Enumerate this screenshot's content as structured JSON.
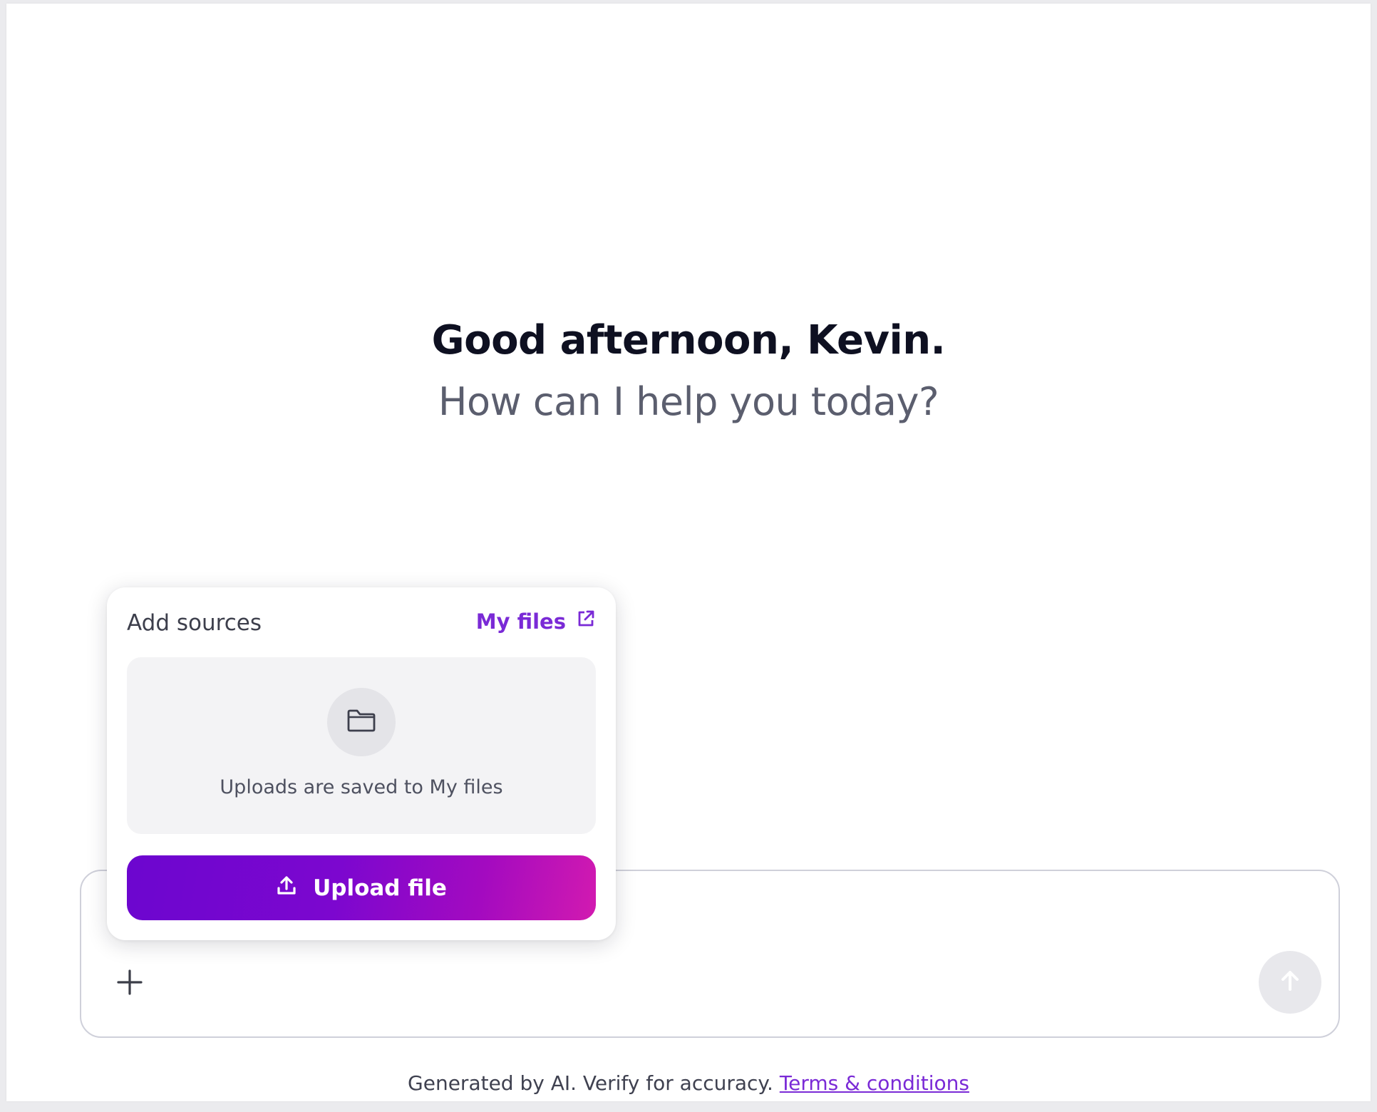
{
  "greeting": {
    "title": "Good afternoon, Kevin.",
    "subtitle": "How can I help you today?"
  },
  "sources_popover": {
    "title": "Add sources",
    "my_files_label": "My files",
    "my_files_icon": "external-link-icon",
    "dropzone_icon": "folder-icon",
    "dropzone_text": "Uploads are saved to My files",
    "upload_icon": "upload-icon",
    "upload_label": "Upload file"
  },
  "composer": {
    "add_icon": "plus-icon",
    "send_icon": "arrow-up-icon"
  },
  "footer": {
    "disclaimer": "Generated by AI. Verify for accuracy.",
    "terms_label": "Terms & conditions"
  },
  "colors": {
    "accent": "#7a2ad6",
    "button_gradient_start": "#6c06cf",
    "button_gradient_end": "#d21ab0",
    "title_text": "#0e1021",
    "subtitle_text": "#5b5e6e"
  }
}
